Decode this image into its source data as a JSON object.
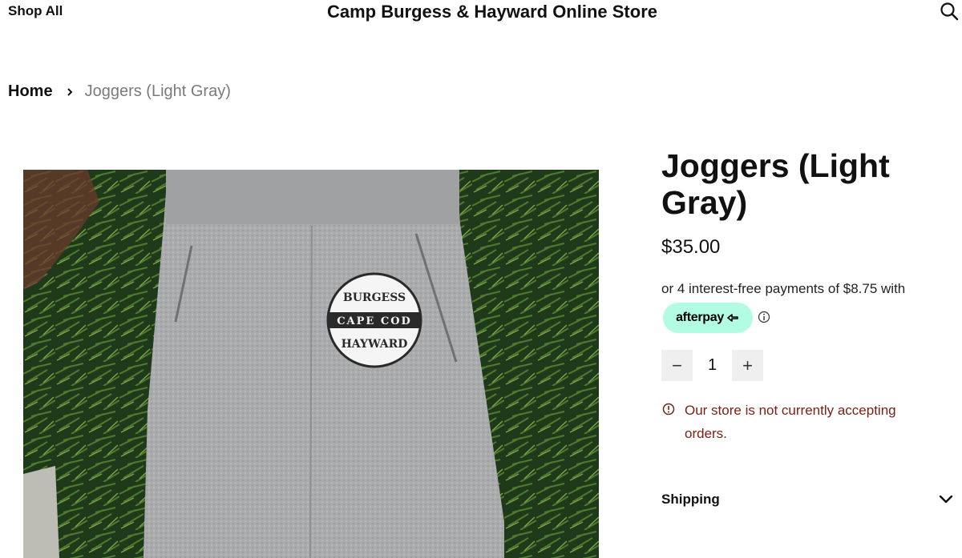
{
  "header": {
    "shop_all": "Shop All",
    "store_title": "Camp Burgess & Hayward Online Store",
    "search_icon": "search-icon"
  },
  "breadcrumb": {
    "home": "Home",
    "separator_icon": "chevron-right-icon",
    "current": "Joggers (Light Gray)"
  },
  "product": {
    "image_logo": {
      "top_text": "BURGESS",
      "middle_text": "CAPE COD",
      "bottom_text": "HAYWARD"
    },
    "title": "Joggers (Light Gray)",
    "price": "$35.00",
    "afterpay_text": "or 4 interest-free payments of $8.75 with",
    "afterpay_label": "afterpay",
    "afterpay_color": "#b2fce4",
    "quantity": {
      "minus": "−",
      "value": "1",
      "plus": "+"
    },
    "warning": "Our store is not currently accepting orders.",
    "warning_color": "#7a1f12",
    "shipping_label": "Shipping"
  }
}
